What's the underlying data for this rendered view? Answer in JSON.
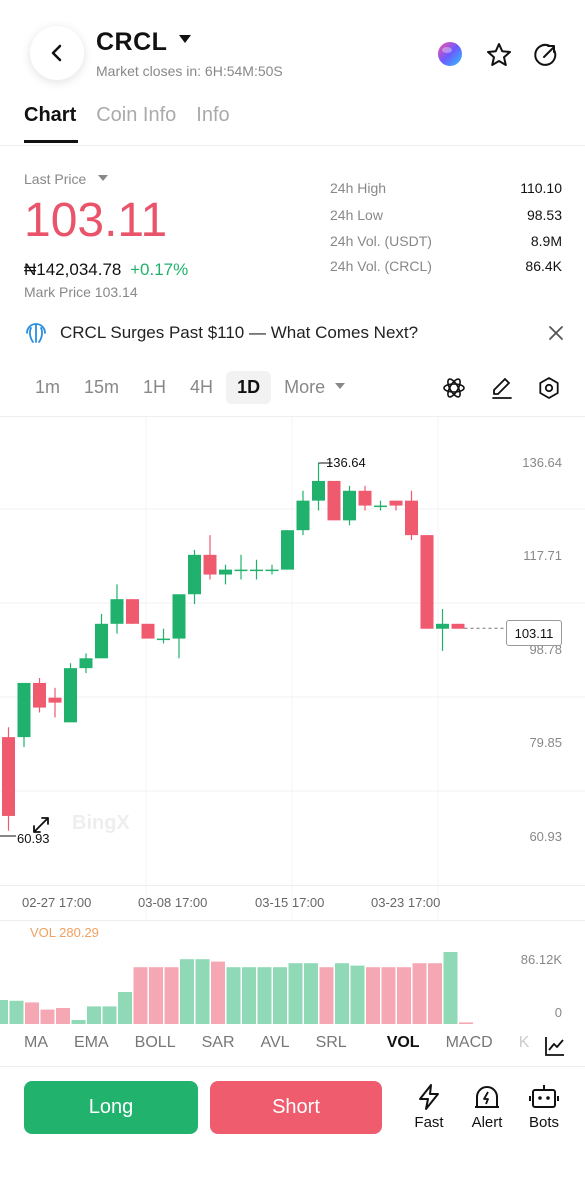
{
  "header": {
    "symbol": "CRCL",
    "market_close": "Market closes in: 6H:54M:50S",
    "icons": [
      "back-arrow-icon",
      "dropdown-caret-icon",
      "ai-orb-icon",
      "star-icon",
      "share-icon"
    ]
  },
  "tabs": [
    "Chart",
    "Coin Info",
    "Info"
  ],
  "price": {
    "label": "Last Price",
    "value": "103.11",
    "fiat": "₦142,034.78",
    "change": "+0.17%",
    "mark": "Mark Price 103.14",
    "color": "#e9546b"
  },
  "stats": [
    {
      "label": "24h High",
      "value": "110.10"
    },
    {
      "label": "24h Low",
      "value": "98.53"
    },
    {
      "label": "24h Vol. (USDT)",
      "value": "8.9M"
    },
    {
      "label": "24h Vol. (CRCL)",
      "value": "86.4K"
    }
  ],
  "news": {
    "text": "CRCL Surges Past $110 — What Comes Next?"
  },
  "intervals": [
    "1m",
    "15m",
    "1H",
    "4H",
    "1D",
    "More"
  ],
  "active_interval": "1D",
  "chart_data": {
    "type": "candlestick",
    "y_ticks": [
      "136.64",
      "117.71",
      "98.78",
      "79.85",
      "60.93"
    ],
    "x_ticks": [
      "02-27 17:00",
      "03-08 17:00",
      "03-15 17:00",
      "03-23 17:00"
    ],
    "high_marker": "136.64",
    "low_marker": "60.93",
    "current_price": "103.11",
    "ylim": [
      60.93,
      136.64
    ],
    "up_color": "#20b26c",
    "down_color": "#ef5a6f",
    "candles": [
      {
        "o": 81,
        "h": 83,
        "l": 62,
        "c": 65
      },
      {
        "o": 81,
        "h": 92,
        "l": 79,
        "c": 92
      },
      {
        "o": 92,
        "h": 93,
        "l": 86,
        "c": 87
      },
      {
        "o": 89,
        "h": 91,
        "l": 85,
        "c": 88
      },
      {
        "o": 84,
        "h": 96,
        "l": 84,
        "c": 95
      },
      {
        "o": 95,
        "h": 98,
        "l": 94,
        "c": 97
      },
      {
        "o": 97,
        "h": 106,
        "l": 97,
        "c": 104
      },
      {
        "o": 104,
        "h": 112,
        "l": 102,
        "c": 109
      },
      {
        "o": 109,
        "h": 109,
        "l": 104,
        "c": 104
      },
      {
        "o": 104,
        "h": 104,
        "l": 101,
        "c": 101
      },
      {
        "o": 101,
        "h": 103,
        "l": 100,
        "c": 101
      },
      {
        "o": 101,
        "h": 108,
        "l": 97,
        "c": 110
      },
      {
        "o": 110,
        "h": 119,
        "l": 108,
        "c": 118
      },
      {
        "o": 118,
        "h": 122,
        "l": 113,
        "c": 114
      },
      {
        "o": 114,
        "h": 116,
        "l": 112,
        "c": 115
      },
      {
        "o": 115,
        "h": 118,
        "l": 113,
        "c": 115
      },
      {
        "o": 115,
        "h": 117,
        "l": 113,
        "c": 115
      },
      {
        "o": 115,
        "h": 116,
        "l": 114,
        "c": 115
      },
      {
        "o": 115,
        "h": 123,
        "l": 115,
        "c": 123
      },
      {
        "o": 123,
        "h": 131,
        "l": 122,
        "c": 129
      },
      {
        "o": 129,
        "h": 136.64,
        "l": 127,
        "c": 133
      },
      {
        "o": 133,
        "h": 133,
        "l": 125,
        "c": 125
      },
      {
        "o": 125,
        "h": 132,
        "l": 124,
        "c": 131
      },
      {
        "o": 131,
        "h": 132,
        "l": 127,
        "c": 128
      },
      {
        "o": 128,
        "h": 129,
        "l": 127,
        "c": 128
      },
      {
        "o": 129,
        "h": 129,
        "l": 127,
        "c": 128
      },
      {
        "o": 129,
        "h": 131,
        "l": 121,
        "c": 122
      },
      {
        "o": 122,
        "h": 122,
        "l": 103,
        "c": 103
      },
      {
        "o": 103,
        "h": 107,
        "l": 98.5,
        "c": 104
      },
      {
        "o": 104,
        "h": 104,
        "l": 103,
        "c": 103
      }
    ]
  },
  "volume": {
    "label": "VOL 280.29",
    "y_ticks": [
      "86.12K",
      "0"
    ],
    "values": [
      30,
      29,
      27,
      18,
      20,
      5,
      22,
      22,
      40,
      71,
      71,
      71,
      81,
      81,
      78,
      71,
      71,
      71,
      71,
      76,
      76,
      71,
      76,
      73,
      71,
      71,
      71,
      76,
      76,
      90,
      2
    ],
    "up": [
      true,
      true,
      false,
      false,
      false,
      true,
      true,
      true,
      true,
      false,
      false,
      false,
      true,
      true,
      false,
      true,
      true,
      true,
      true,
      true,
      true,
      false,
      true,
      true,
      false,
      false,
      false,
      false,
      false,
      true,
      false
    ]
  },
  "indicators": [
    "MA",
    "EMA",
    "BOLL",
    "SAR",
    "AVL",
    "SRL",
    "VOL",
    "MACD",
    "K"
  ],
  "active_indicator": "VOL",
  "actions": {
    "long": "Long",
    "short": "Short",
    "long_color": "#21b26e",
    "short_color": "#ef5c6e"
  },
  "tools": [
    {
      "label": "Fast",
      "icon": "lightning-icon"
    },
    {
      "label": "Alert",
      "icon": "alarm-icon"
    },
    {
      "label": "Bots",
      "icon": "robot-icon"
    }
  ],
  "watermark": "BingX"
}
